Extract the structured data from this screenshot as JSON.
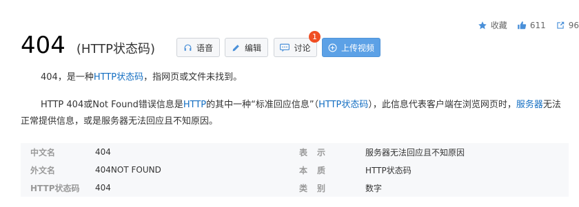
{
  "actions": {
    "favorite_label": "收藏",
    "like_count": "611",
    "share_count": "96"
  },
  "title": {
    "main": "404",
    "sub": "(HTTP状态码)"
  },
  "buttons": {
    "audio": "语音",
    "edit": "编辑",
    "discuss": "讨论",
    "discuss_badge": "1",
    "upload": "上传视频"
  },
  "para1": {
    "t1": "404，是一种",
    "link1": "HTTP状态码",
    "t2": "，指网页或文件未找到。"
  },
  "para2": {
    "t1": "HTTP 404或Not Found错误信息是",
    "link1": "HTTP",
    "t2": "的其中一种“标准回应信息”（",
    "link2": "HTTP状态码",
    "t3": "），此信息代表客户端在浏览网页时，",
    "link3": "服务器",
    "t4": "无法正常提供信息，或是服务器无法回应且不知原因。"
  },
  "info_table": [
    {
      "k1": "中文名",
      "v1": "404",
      "k2": "表示",
      "v2": "服务器无法回应且不知原因"
    },
    {
      "k1": "外文名",
      "v1": "404NOT FOUND",
      "k2": "本质",
      "v2": "HTTP状态码"
    },
    {
      "k1": "HTTP状态码",
      "v1": "404",
      "k2": "类别",
      "v2": "数字"
    }
  ],
  "colors": {
    "link": "#136ec2",
    "upload_button": "#5ca1e6",
    "badge": "#f04e23",
    "icon": "#4a90d9"
  },
  "icons": [
    "star-icon",
    "thumbs-up-icon",
    "share-icon",
    "headphones-icon",
    "pencil-icon",
    "chat-icon",
    "plus-circle-icon"
  ]
}
